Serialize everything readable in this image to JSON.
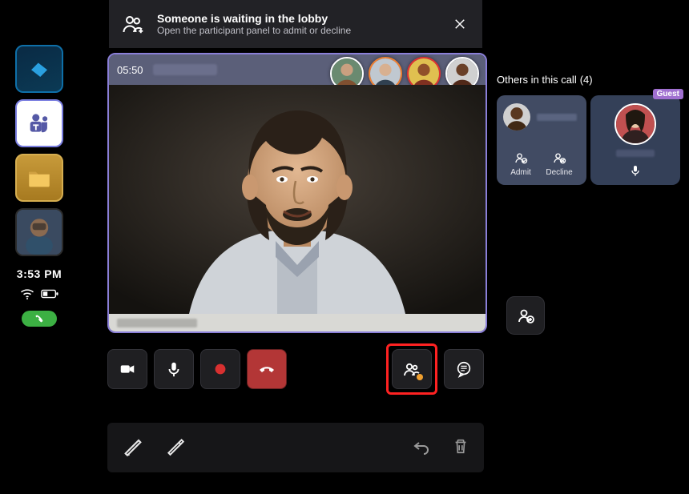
{
  "left_rail": {
    "apps": [
      {
        "name": "app-dynamics-icon"
      },
      {
        "name": "app-teams-icon"
      },
      {
        "name": "app-files-icon"
      },
      {
        "name": "app-avatar-icon"
      }
    ],
    "clock": "3:53 PM"
  },
  "lobby_banner": {
    "title": "Someone is waiting in the lobby",
    "subtitle": "Open the participant panel to admit or decline"
  },
  "video": {
    "timer": "05:50"
  },
  "call_controls": {
    "camera": "camera",
    "mic": "mic",
    "record": "record",
    "endcall": "end-call",
    "participants": "participants",
    "chat": "chat"
  },
  "others_panel": {
    "title": "Others in this call",
    "count_label": "(4)",
    "card1": {
      "admit_label": "Admit",
      "decline_label": "Decline"
    },
    "card2": {
      "guest_label": "Guest"
    }
  }
}
